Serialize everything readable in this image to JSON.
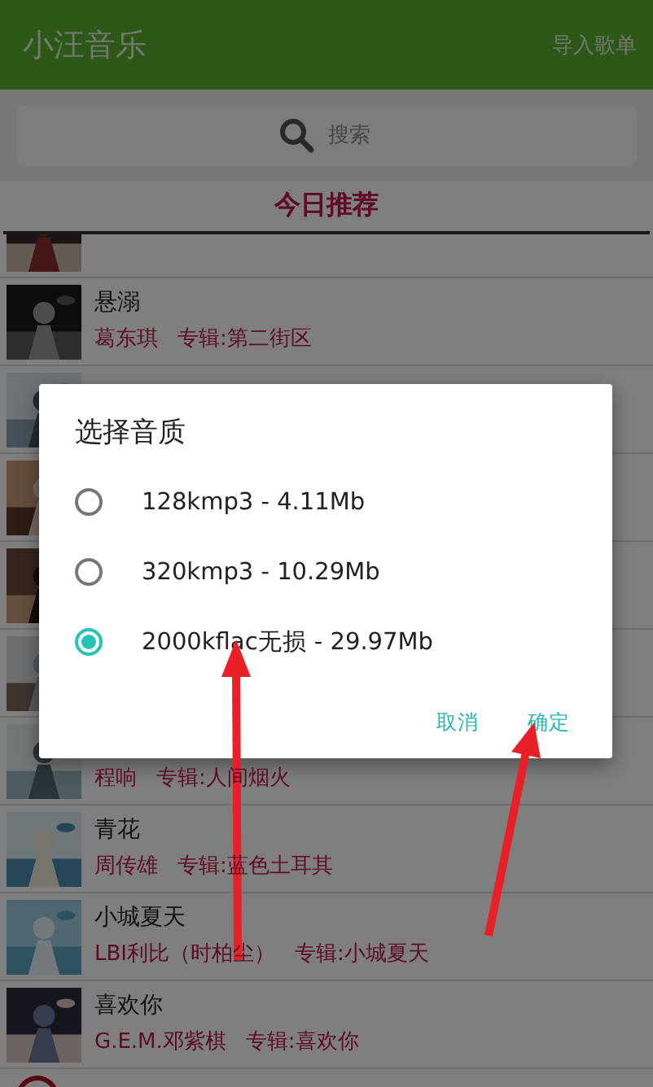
{
  "app_bar": {
    "title": "小汪音乐",
    "action": "导入歌单"
  },
  "search": {
    "placeholder": "搜索"
  },
  "section": {
    "title": "今日推荐"
  },
  "songs": [
    {
      "kind": "song",
      "cut": true
    },
    {
      "kind": "song",
      "title": "悬溺",
      "artist": "葛东琪",
      "album": "专辑:第二街区"
    },
    {
      "kind": "song"
    },
    {
      "kind": "song"
    },
    {
      "kind": "song"
    },
    {
      "kind": "song"
    },
    {
      "kind": "song",
      "artist": "程响",
      "album": "专辑:人间烟火"
    },
    {
      "kind": "song",
      "title": "青花",
      "artist": "周传雄",
      "album": "专辑:蓝色土耳其"
    },
    {
      "kind": "song",
      "title": "小城夏天",
      "artist": "LBI利比（时柏尘）",
      "album": "专辑:小城夏天"
    },
    {
      "kind": "song",
      "title": "喜欢你",
      "artist": "G.E.M.邓紫棋",
      "album": "专辑:喜欢你"
    },
    {
      "kind": "local"
    }
  ],
  "dialog": {
    "title": "选择音质",
    "options": [
      {
        "label": "128kmp3 - 4.11Mb",
        "selected": false
      },
      {
        "label": "320kmp3 - 10.29Mb",
        "selected": false
      },
      {
        "label": "2000kflac无损 - 29.97Mb",
        "selected": true
      }
    ],
    "buttons": [
      "取消",
      "确定"
    ]
  },
  "annotations": [
    {
      "kind": "arrow"
    },
    {
      "kind": "arrow"
    }
  ]
}
